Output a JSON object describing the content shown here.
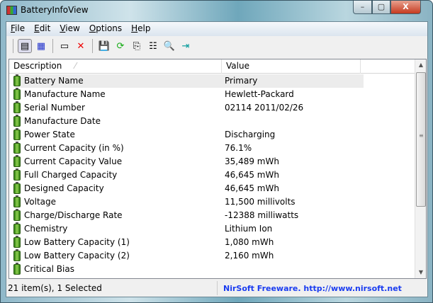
{
  "window": {
    "title": "BatteryInfoView",
    "minimize": "–",
    "maximize": "▢",
    "close": "X"
  },
  "menu": [
    "File",
    "Edit",
    "View",
    "Options",
    "Help"
  ],
  "toolbar": [
    {
      "icon": "html-report-icon",
      "glyph": "▤"
    },
    {
      "icon": "clipboard-report-icon",
      "glyph": "▦"
    },
    {
      "icon": "window-icon",
      "glyph": "▭"
    },
    {
      "icon": "delete-icon",
      "glyph": "✕"
    },
    {
      "icon": "save-icon",
      "glyph": "💾"
    },
    {
      "icon": "refresh-icon",
      "glyph": "⟳"
    },
    {
      "icon": "copy-icon",
      "glyph": "⎘"
    },
    {
      "icon": "properties-icon",
      "glyph": "☷"
    },
    {
      "icon": "find-icon",
      "glyph": "🔍"
    },
    {
      "icon": "exit-icon",
      "glyph": "⇥"
    }
  ],
  "columns": {
    "description": "Description",
    "value": "Value"
  },
  "rows": [
    {
      "description": "Battery Name",
      "value": "Primary"
    },
    {
      "description": "Manufacture Name",
      "value": "Hewlett-Packard"
    },
    {
      "description": "Serial Number",
      "value": "02114 2011/02/26"
    },
    {
      "description": "Manufacture Date",
      "value": ""
    },
    {
      "description": "Power State",
      "value": "Discharging"
    },
    {
      "description": "Current Capacity (in %)",
      "value": "76.1%"
    },
    {
      "description": "Current Capacity Value",
      "value": "35,489 mWh"
    },
    {
      "description": "Full Charged Capacity",
      "value": "46,645 mWh"
    },
    {
      "description": "Designed Capacity",
      "value": "46,645 mWh"
    },
    {
      "description": "Voltage",
      "value": "11,500 millivolts"
    },
    {
      "description": "Charge/Discharge Rate",
      "value": "-12388 milliwatts"
    },
    {
      "description": "Chemistry",
      "value": "Lithium Ion"
    },
    {
      "description": "Low Battery Capacity (1)",
      "value": "1,080 mWh"
    },
    {
      "description": "Low Battery Capacity (2)",
      "value": "2,160 mWh"
    },
    {
      "description": "Critical Bias",
      "value": ""
    }
  ],
  "status": {
    "items": "21 item(s), 1 Selected",
    "credit": "NirSoft Freeware.  http://www.nirsoft.net"
  },
  "colors": {
    "credit": "#1a3cf0",
    "selected_row": "#ececec"
  }
}
